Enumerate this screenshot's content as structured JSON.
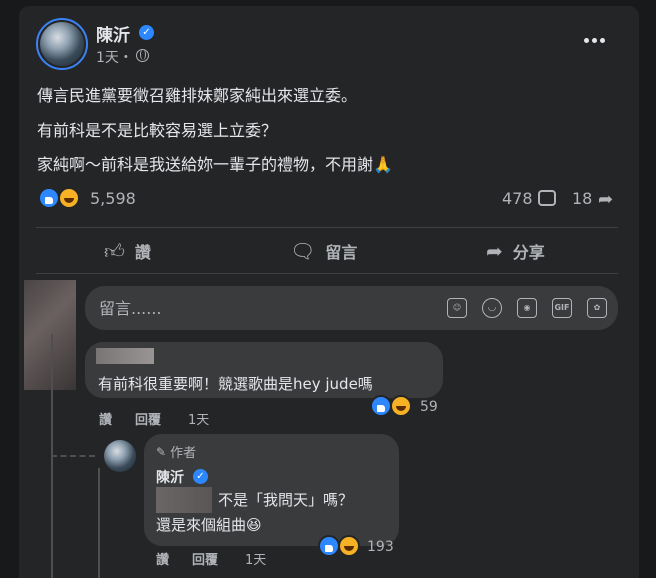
{
  "post": {
    "author": "陳沂",
    "time": "1天・",
    "lines": [
      "傳言民進黨要徵召雞排妹鄭家純出來選立委。",
      "有前科是不是比較容易選上立委？",
      "家純啊～前科是我送給妳一輩子的禮物，不用謝🙏"
    ],
    "reaction_count": "5,598",
    "comment_count": "478",
    "share_count": "18"
  },
  "actions": {
    "like": "讚",
    "comment": "留言",
    "share": "分享"
  },
  "comment_input": {
    "placeholder": "留言......"
  },
  "comments": [
    {
      "text": "有前科很重要啊！競選歌曲是hey jude嗎",
      "like_label": "讚",
      "reply_label": "回覆",
      "time": "1天",
      "reaction_count": "59"
    }
  ],
  "reply": {
    "badge": "作者",
    "author": "陳沂",
    "line1": "不是「我問天」嗎？",
    "line2": "還是來個組曲😆",
    "like_label": "讚",
    "reply_label": "回覆",
    "time": "1天",
    "reaction_count": "193"
  },
  "colors": {
    "background": "#18191a",
    "card": "#242526",
    "bubble": "#3a3b3c",
    "accent": "#2d88ff",
    "haha": "#f7b125"
  }
}
